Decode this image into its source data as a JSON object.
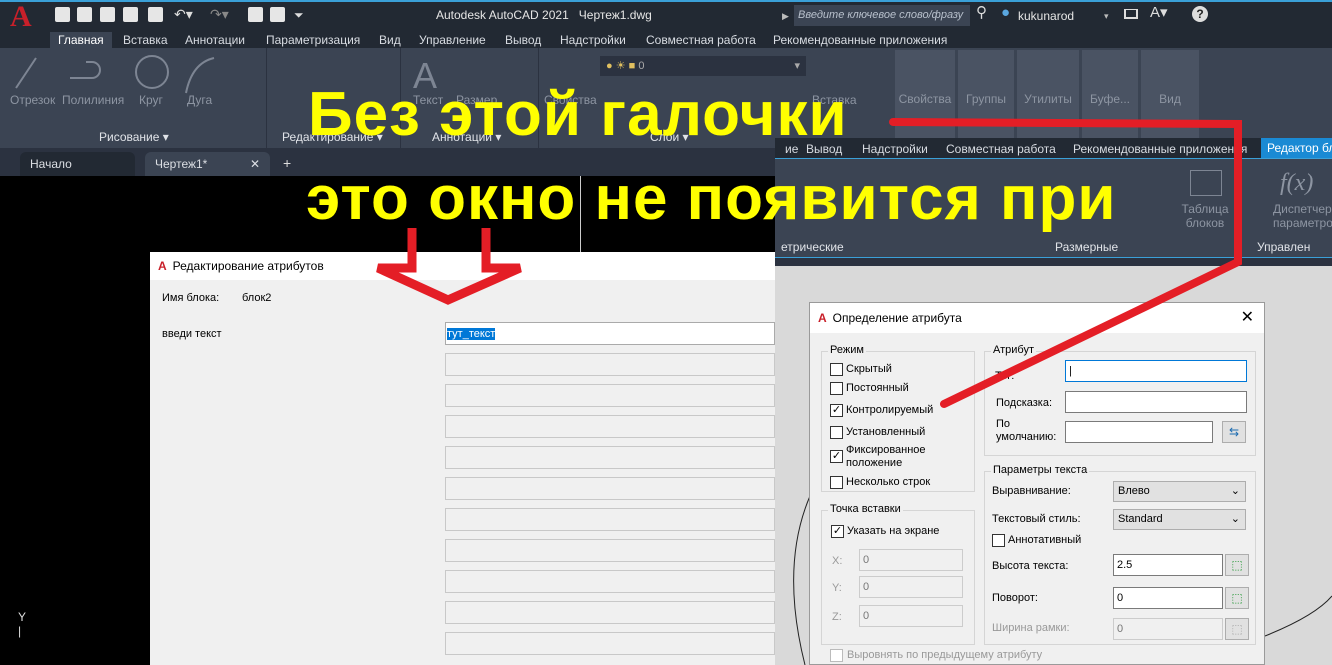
{
  "app": {
    "title": "Autodesk AutoCAD 2021",
    "file": "Чертеж1.dwg",
    "search_placeholder": "Введите ключевое слово/фразу",
    "user": "kukunarod"
  },
  "ribbon_tabs": [
    "Главная",
    "Вставка",
    "Аннотации",
    "Параметризация",
    "Вид",
    "Управление",
    "Вывод",
    "Надстройки",
    "Совместная работа",
    "Рекомендованные приложения"
  ],
  "tools": {
    "line": "Отрезок",
    "polyline": "Полилиния",
    "circle": "Круг",
    "arc": "Дуга",
    "text": "Текст",
    "dim": "Размер",
    "props": "Свойства",
    "insert": "Вставка",
    "properties": "Свойства",
    "groups": "Группы",
    "utils": "Утилиты",
    "clipboard": "Буфе...",
    "view": "Вид",
    "layer": "0"
  },
  "panels": {
    "draw": "Рисование ▾",
    "modify": "Редактирование ▾",
    "annot": "Аннотации ▾",
    "layers": "Слои ▾"
  },
  "doc_tabs": [
    "Начало",
    "Чертеж1*"
  ],
  "overlay_tabs": [
    "ие",
    "Вывод",
    "Надстройки",
    "Совместная работа",
    "Рекомендованные приложения",
    "Редактор бл"
  ],
  "overlay_tools": {
    "table": "Таблица блоков",
    "param": "Диспетчер параметров",
    "geom": "етрические",
    "dims": "Размерные",
    "manage": "Управлен"
  },
  "edit_dialog": {
    "title": "Редактирование атрибутов",
    "block_label": "Имя блока:",
    "block_name": "блок2",
    "prompt": "введи текст",
    "value": "тут_текст"
  },
  "attr_dialog": {
    "title": "Определение атрибута",
    "mode_group": "Режим",
    "modes": [
      {
        "label": "Скрытый",
        "checked": false
      },
      {
        "label": "Постоянный",
        "checked": false
      },
      {
        "label": "Контролируемый",
        "checked": true
      },
      {
        "label": "Установленный",
        "checked": false
      },
      {
        "label": "Фиксированное положение",
        "checked": true
      },
      {
        "label": "Несколько строк",
        "checked": false
      }
    ],
    "insert_group": "Точка вставки",
    "on_screen": "Указать на экране",
    "x_label": "X:",
    "y_label": "Y:",
    "z_label": "Z:",
    "x": "0",
    "y": "0",
    "z": "0",
    "attr_group": "Атрибут",
    "tag_label": "Тег:",
    "prompt_label": "Подсказка:",
    "default_label": "По умолчанию:",
    "text_group": "Параметры текста",
    "justify_label": "Выравнивание:",
    "justify": "Влево",
    "style_label": "Текстовый стиль:",
    "style": "Standard",
    "annotative": "Аннотативный",
    "height_label": "Высота текста:",
    "height": "2.5",
    "rotation_label": "Поворот:",
    "rotation": "0",
    "width_label": "Ширина рамки:",
    "width": "0",
    "align_prev": "Выровнять по предыдущему атрибуту"
  },
  "annotation": {
    "line1": "Без этой галочки",
    "line2": "это окно не появится при"
  },
  "colors": {
    "accent": "#3aa0d8",
    "annotation_text": "#ffff00",
    "annotation_arrow": "#e41e26"
  }
}
